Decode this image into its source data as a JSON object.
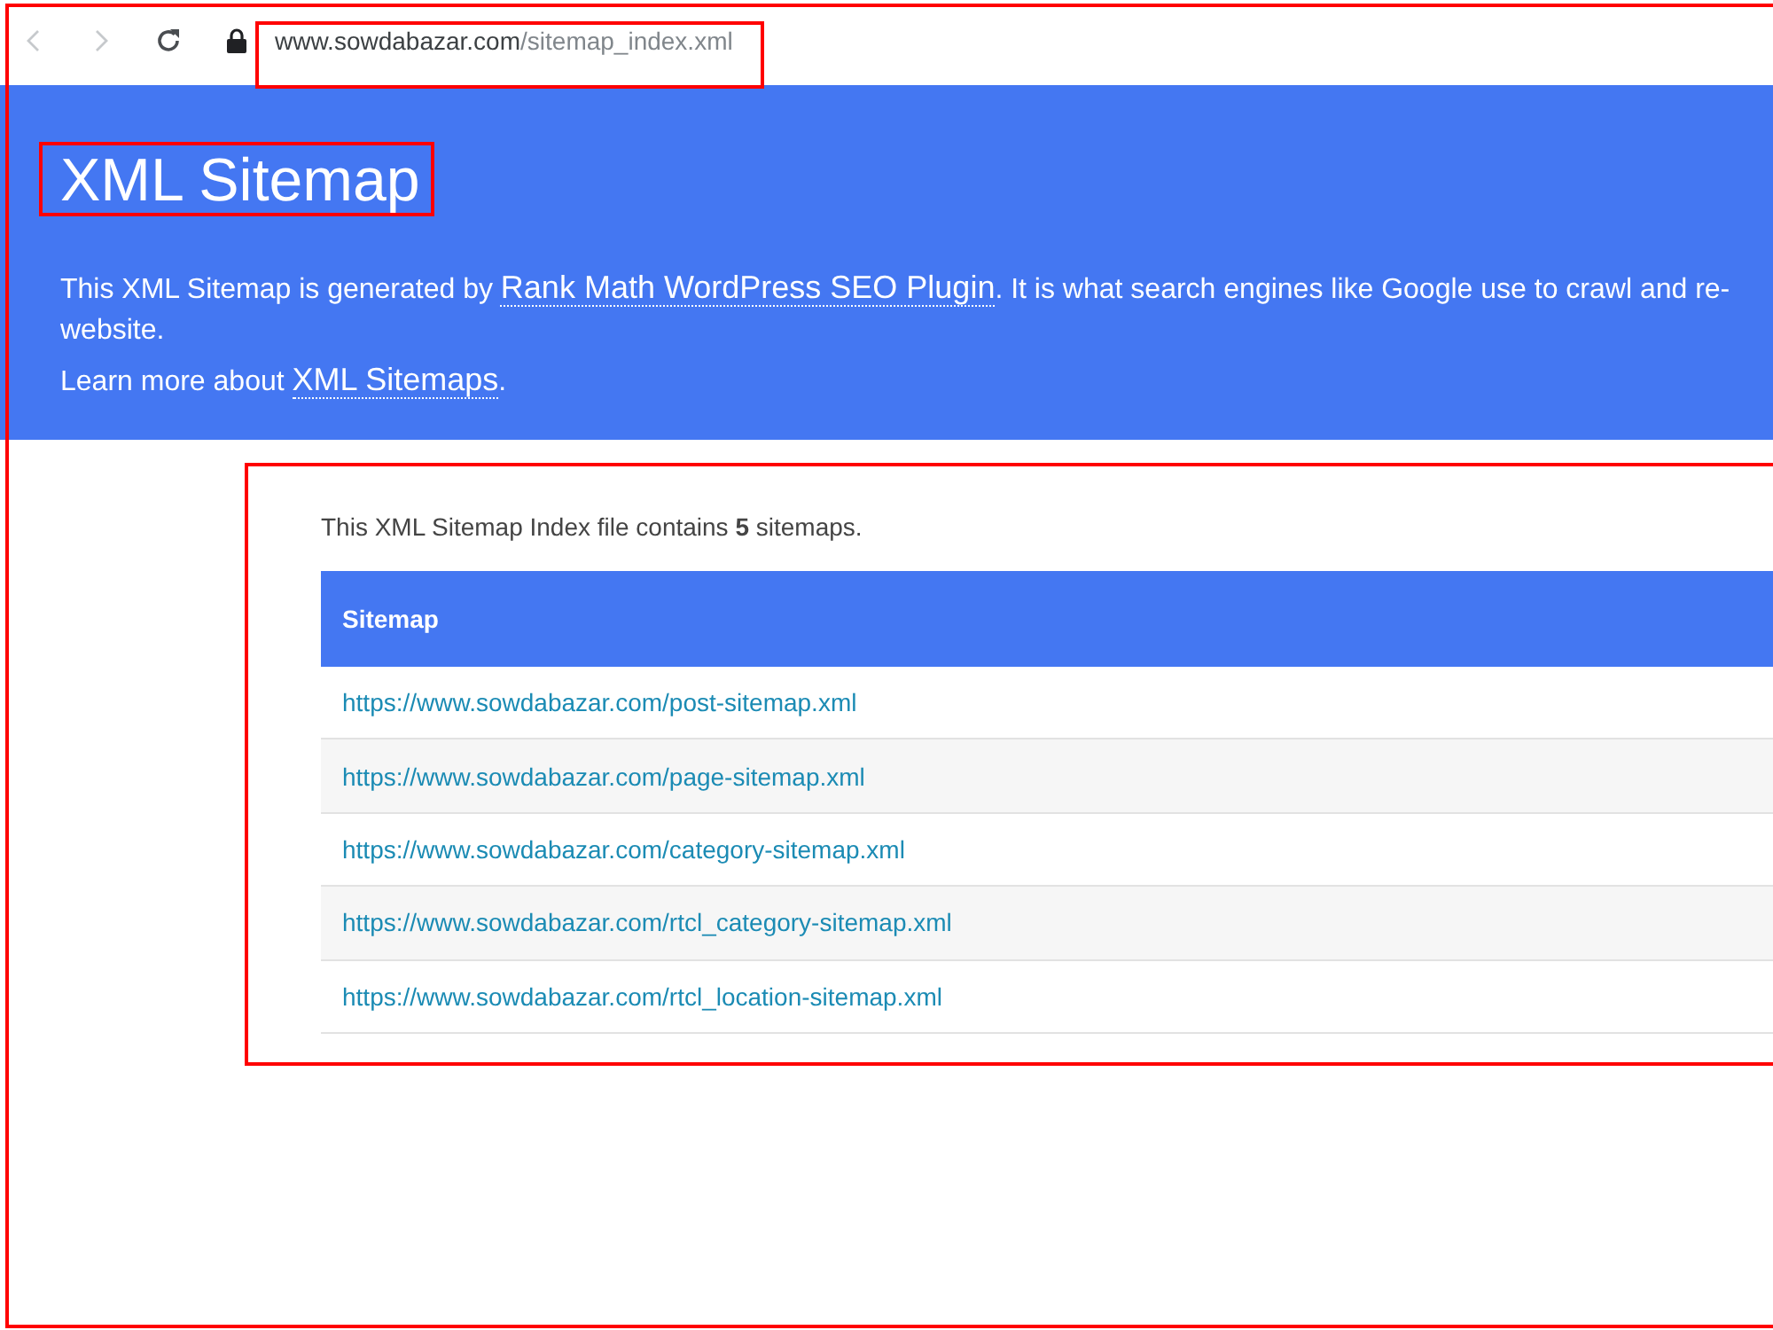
{
  "page_highlighted": true,
  "browser_toolbar": {
    "nav_buttons": [
      {
        "kind": "back",
        "disabled": true
      },
      {
        "kind": "forward",
        "disabled": true
      },
      {
        "kind": "reload",
        "disabled": false
      }
    ],
    "secure": true,
    "url_host": "www.sowdabazar.com",
    "url_path": "/sitemap_index.xml",
    "url_highlighted": true
  },
  "header": {
    "title": "XML Sitemap",
    "title_highlighted": true,
    "intro": {
      "text_before": "This XML Sitemap is generated by ",
      "link": "Rank Math WordPress SEO Plugin",
      "text_after": ". It is what search engines like Google use to crawl and re-",
      "continuation": "website."
    },
    "learn_more": {
      "text_before": "Learn more about ",
      "link": "XML Sitemaps",
      "text_after": "."
    }
  },
  "content": {
    "highlighted": true,
    "summary": "This XML Sitemap Index file contains **5** sitemaps.",
    "table": {
      "columns": [
        "Sitemap"
      ],
      "rows": [
        {
          "url": "https://www.sowdabazar.com/post-sitemap.xml"
        },
        {
          "url": "https://www.sowdabazar.com/page-sitemap.xml"
        },
        {
          "url": "https://www.sowdabazar.com/category-sitemap.xml"
        },
        {
          "url": "https://www.sowdabazar.com/rtcl_category-sitemap.xml"
        },
        {
          "url": "https://www.sowdabazar.com/rtcl_location-sitemap.xml"
        }
      ]
    }
  }
}
